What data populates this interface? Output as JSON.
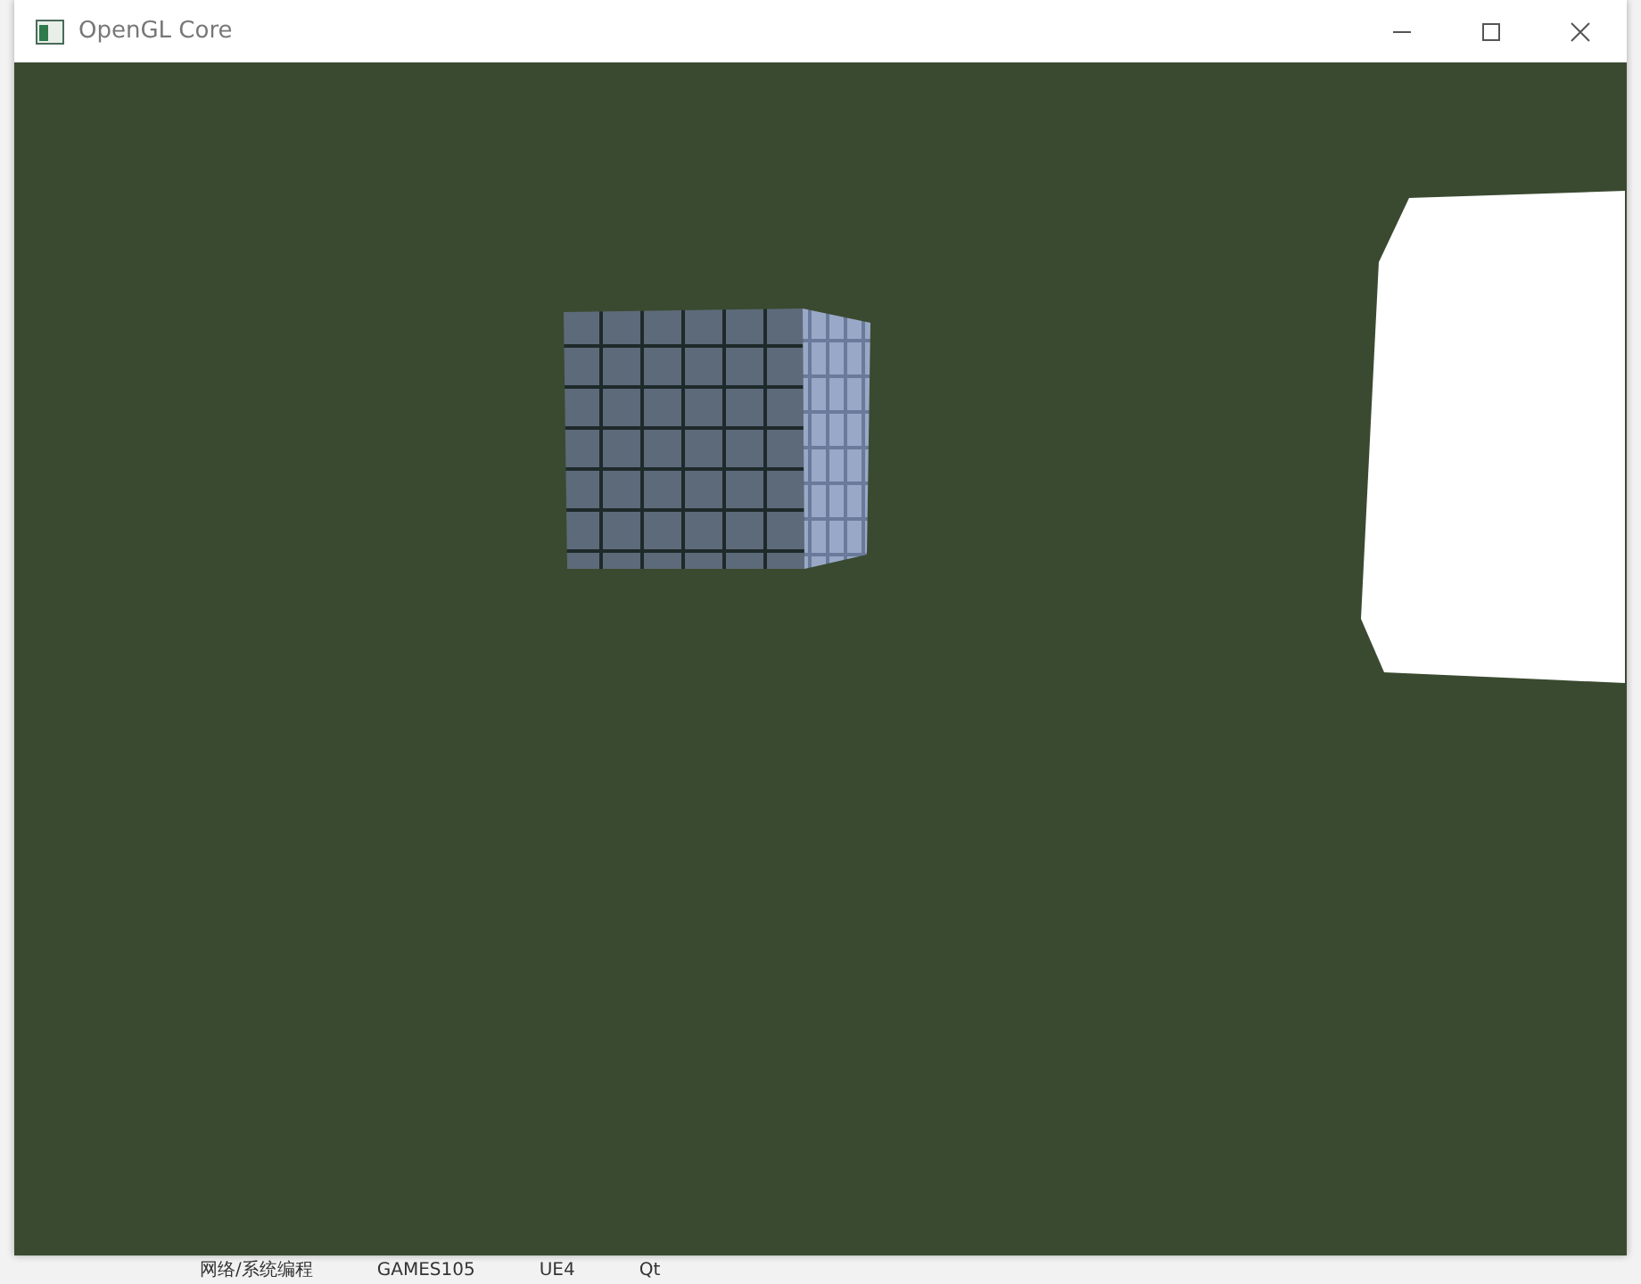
{
  "window": {
    "title": "OpenGL Core"
  },
  "background_bar": {
    "items": [
      "网络/系统编程",
      "GAMES105",
      "UE4",
      "Qt"
    ]
  }
}
